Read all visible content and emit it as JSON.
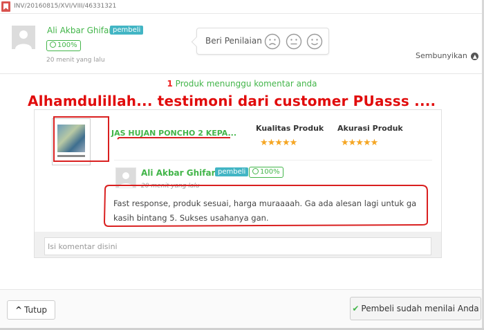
{
  "invoice": {
    "number": "INV/20160815/XVI/VIII/46331321",
    "icon": "bookmark-icon"
  },
  "seller": {
    "name": "Ali Akbar Ghifari",
    "badge": "pembeli",
    "reputation": "100%",
    "time": "20 menit yang lalu"
  },
  "rating_prompt": {
    "label": "Beri Penilaian",
    "faces": [
      "sad-face-icon",
      "neutral-face-icon",
      "smile-face-icon"
    ]
  },
  "hide_label": "Sembunyikan",
  "pending": {
    "count": "1",
    "text": "Produk menunggu komentar anda"
  },
  "banner": "Alhamdulillah... testimoni dari customer PUasss ....",
  "product": {
    "name": "JAS HUJAN PONCHO 2 KEPA...",
    "quality_label": "Kualitas Produk",
    "accuracy_label": "Akurasi Produk",
    "quality_stars": "★★★★★",
    "accuracy_stars": "★★★★★",
    "quality_rating": 5,
    "accuracy_rating": 5
  },
  "review": {
    "name": "Ali Akbar Ghifari",
    "badge": "pembeli",
    "reputation": "100%",
    "time": "20 menit yang lalu",
    "text": "Fast response, produk sesuai, harga muraaaah. Ga ada alesan lagi untuk ga kasih bintang 5. Sukses usahanya gan."
  },
  "comment": {
    "placeholder": "Isi komentar disini"
  },
  "footer": {
    "close_label": "Tutup",
    "status_label": "Pembeli sudah menilai Anda"
  },
  "colors": {
    "green": "#42b549",
    "badge": "#42b5c4",
    "annotation_red": "#d91f1f",
    "star": "#f5a623"
  }
}
